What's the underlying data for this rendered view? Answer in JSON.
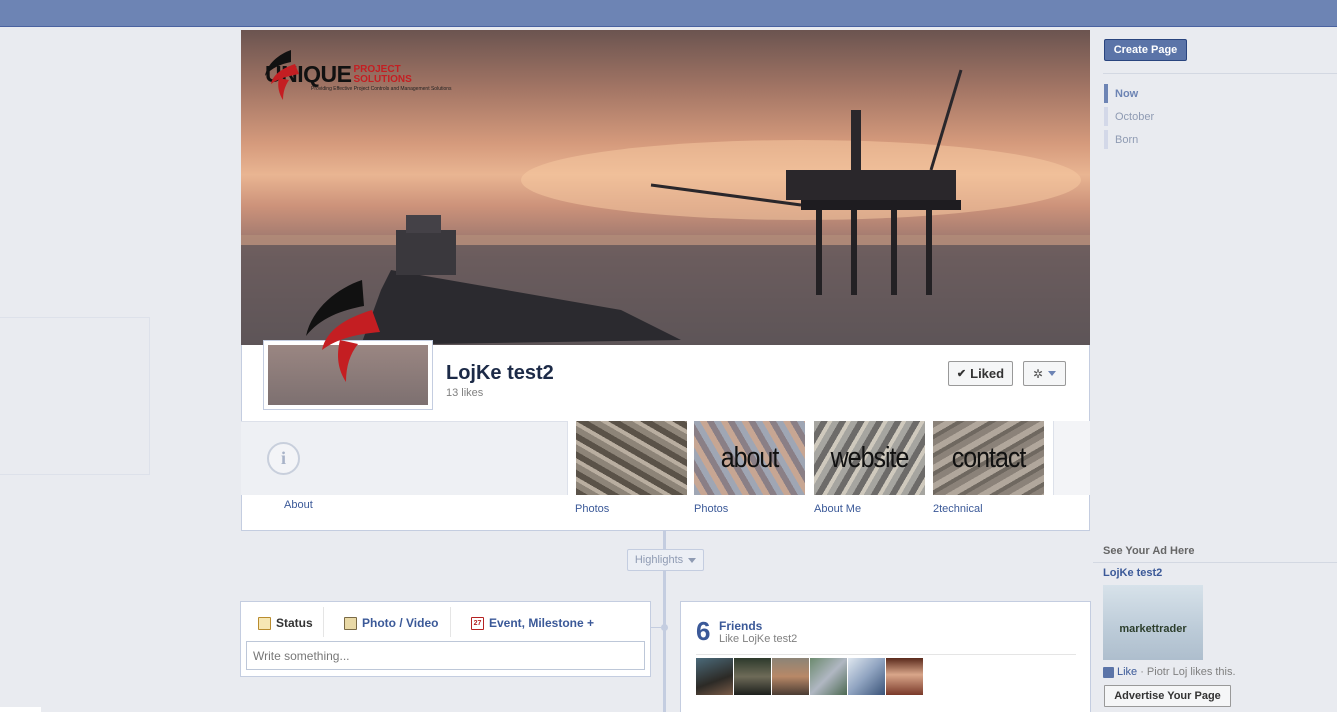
{
  "page": {
    "name": "LojKe test2",
    "likes": "13 likes",
    "liked_label": "Liked"
  },
  "cover_logo": {
    "word": "UNIQUE",
    "sub": "PROJECT SOLUTIONS",
    "tagline": "Providing Effective Project Controls and Management Solutions"
  },
  "apps": [
    {
      "label": "About"
    },
    {
      "label": "Photos",
      "overlay": ""
    },
    {
      "label": "Photos",
      "overlay": "about"
    },
    {
      "label": "About Me",
      "overlay": "website"
    },
    {
      "label": "2technical",
      "overlay": "contact"
    }
  ],
  "timeline": {
    "highlights_label": "Highlights"
  },
  "composer": {
    "tabs": [
      "Status",
      "Photo / Video",
      "Event, Milestone +"
    ],
    "calendar_day": "27",
    "placeholder": "Write something..."
  },
  "friends": {
    "count": "6",
    "title": "Friends",
    "subtitle": "Like LojKe test2"
  },
  "sidebar": {
    "create_page": "Create Page",
    "scrubber": [
      "Now",
      "October",
      "Born"
    ]
  },
  "ad": {
    "heading": "See Your Ad Here",
    "title": "LojKe test2",
    "image_text": "markettrader",
    "like": "Like",
    "like_tail": "· Piotr Loj likes this.",
    "advertise": "Advertise Your Page"
  },
  "colors": {
    "topbar": "#6d84b4",
    "link": "#3b5998",
    "background": "#e9ebf0"
  }
}
